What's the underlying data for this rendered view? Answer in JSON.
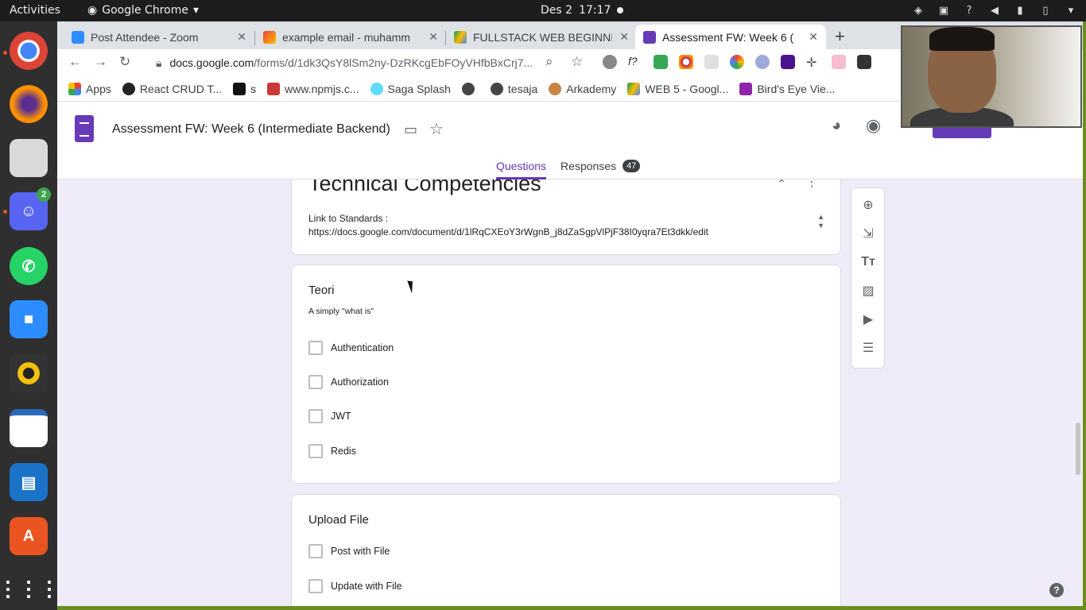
{
  "system": {
    "activities": "Activities",
    "app_name": "Google Chrome",
    "date": "Des 2",
    "time": "17:17"
  },
  "dock": {
    "discord_badge": "2"
  },
  "browser": {
    "tabs": [
      {
        "label": "Post Attendee - Zoom",
        "close": "✕"
      },
      {
        "label": "example email - muhamm",
        "close": "✕"
      },
      {
        "label": "FULLSTACK WEB BEGINNI",
        "close": "✕"
      },
      {
        "label": "Assessment FW: Week 6 (",
        "close": "✕"
      }
    ],
    "new_tab": "+",
    "url_host": "docs.google.com",
    "url_path": "/forms/d/1dk3QsY8lSm2ny-DzRKcgEbFOyVHfbBxCrj7...",
    "bookmarks": [
      "Apps",
      "React CRUD T...",
      "s",
      "www.npmjs.c...",
      "Saga Splash",
      "",
      "tesaja",
      "Arkademy",
      "WEB 5 - Googl...",
      "Bird's Eye Vie..."
    ]
  },
  "form": {
    "doc_title": "Assessment FW: Week 6 (Intermediate Backend)",
    "tabs": {
      "questions": "Questions",
      "responses": "Responses",
      "responses_count": "47"
    },
    "section": {
      "title": "Technical Competencies",
      "desc_line1": "Link to Standards :",
      "desc_line2": "https://docs.google.com/document/d/1lRqCXEoY3rWgnB_j8dZaSgpVlPjF38I0yqra7Et3dkk/edit"
    },
    "question1": {
      "title": "Teori",
      "description": "A simply \"what is\"",
      "options": [
        "Authentication",
        "Authorization",
        "JWT",
        "Redis"
      ]
    },
    "question2": {
      "title": "Upload File",
      "options": [
        "Post with File",
        "Update with File"
      ]
    },
    "help": "?"
  },
  "colors": {
    "accent": "#673ab7",
    "background": "#f0ebf8",
    "frame_green": "#6b8e23"
  }
}
